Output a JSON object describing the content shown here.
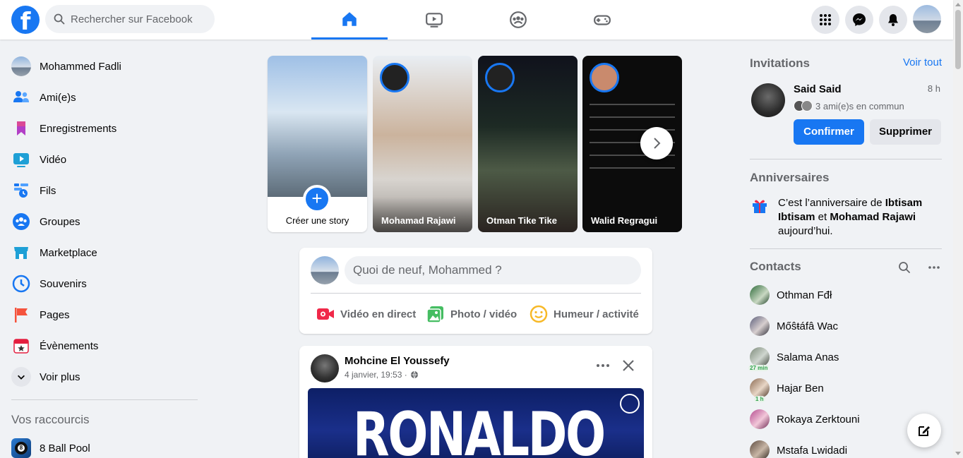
{
  "search": {
    "placeholder": "Rechercher sur Facebook"
  },
  "nav": {
    "tabs": [
      "Accueil",
      "Watch",
      "Groupes",
      "Gaming"
    ]
  },
  "user": {
    "name": "Mohammed Fadli"
  },
  "sidebar": {
    "items": [
      {
        "label": "Mohammed Fadli",
        "icon": "avatar"
      },
      {
        "label": "Ami(e)s",
        "icon": "friends-icon"
      },
      {
        "label": "Enregistrements",
        "icon": "bookmark-icon"
      },
      {
        "label": "Vidéo",
        "icon": "video-icon"
      },
      {
        "label": "Fils",
        "icon": "feeds-icon"
      },
      {
        "label": "Groupes",
        "icon": "groups-icon"
      },
      {
        "label": "Marketplace",
        "icon": "marketplace-icon"
      },
      {
        "label": "Souvenirs",
        "icon": "clock-icon"
      },
      {
        "label": "Pages",
        "icon": "flag-icon"
      },
      {
        "label": "Évènements",
        "icon": "calendar-icon"
      },
      {
        "label": "Voir plus",
        "icon": "chevron-down-icon"
      }
    ],
    "shortcuts_title": "Vos raccourcis",
    "shortcuts": [
      {
        "label": "8 Ball Pool",
        "icon": "eight-ball-icon"
      }
    ]
  },
  "stories": {
    "create_label": "Créer une story",
    "items": [
      {
        "name": "Mohamad Rajawi"
      },
      {
        "name": "Otman Tike Tike"
      },
      {
        "name": "Walid Regragui"
      }
    ]
  },
  "composer": {
    "prompt": "Quoi de neuf, Mohammed ?",
    "actions": [
      "Vidéo en direct",
      "Photo / vidéo",
      "Humeur / activité"
    ]
  },
  "post": {
    "author": "Mohcine El Youssefy",
    "time": "4 janvier, 19:53 ·",
    "banner_text": "RONALDO"
  },
  "invitations": {
    "title": "Invitations",
    "see_all": "Voir tout",
    "name": "Said Said",
    "time": "8 h",
    "mutual": "3 ami(e)s en commun",
    "confirm": "Confirmer",
    "delete": "Supprimer"
  },
  "birthdays": {
    "title": "Anniversaires",
    "prefix": "C’est l’anniversaire de ",
    "name1": "Ibtisam Ibtisam",
    "middle": " et ",
    "name2": "Mohamad Rajawi",
    "suffix": " aujourd’hui."
  },
  "contacts": {
    "title": "Contacts",
    "items": [
      {
        "name": "Othman Fđł",
        "badge": ""
      },
      {
        "name": "Mőŝŧáfâ Wac",
        "badge": ""
      },
      {
        "name": "Salama Anas",
        "badge": "27 min"
      },
      {
        "name": "Hajar Ben",
        "badge": "1 h"
      },
      {
        "name": "Rokaya Zerktouni",
        "badge": ""
      },
      {
        "name": "Mstafa Lwidadi",
        "badge": ""
      }
    ]
  },
  "colors": {
    "brand": "#1877f2",
    "background": "#f0f2f5"
  }
}
